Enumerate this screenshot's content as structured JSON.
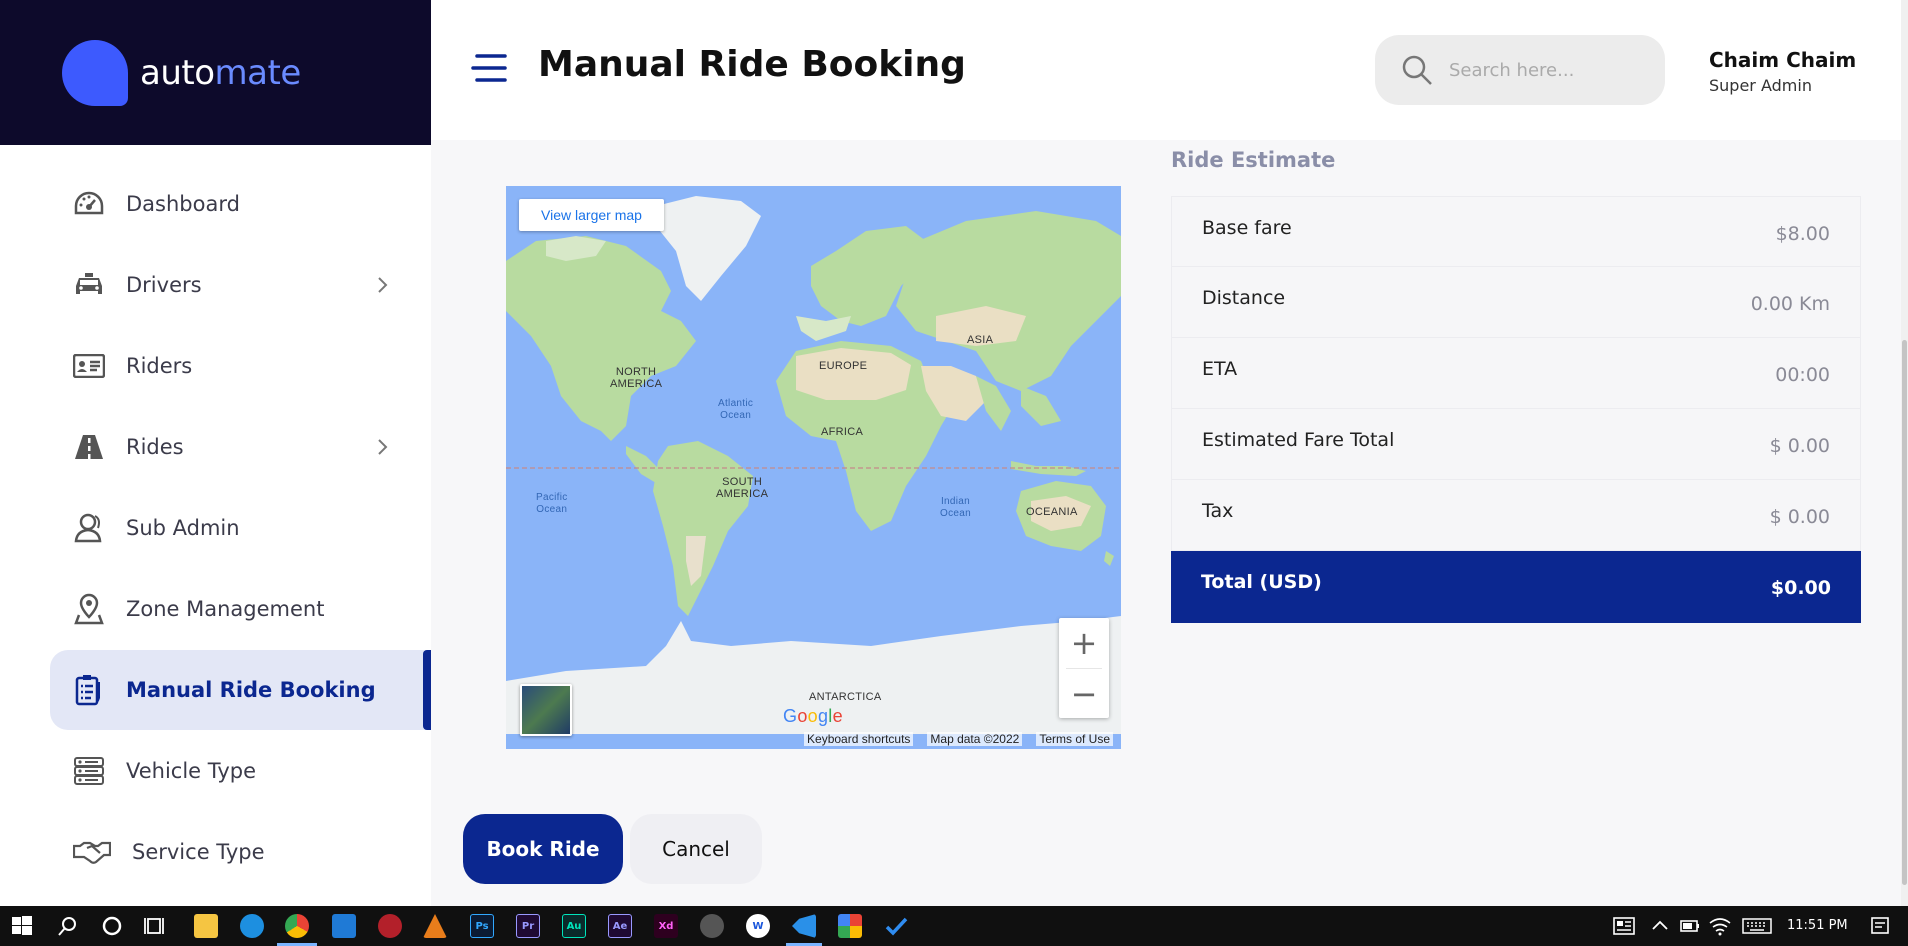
{
  "app": {
    "brand_part1": "auto",
    "brand_part2": "mate",
    "page_title": "Manual Ride Booking"
  },
  "header": {
    "search_placeholder": "Search here...",
    "user_name": "Chaim Chaim",
    "user_role": "Super Admin"
  },
  "sidebar": {
    "items": [
      {
        "label": "Dashboard",
        "icon": "dashboard-icon"
      },
      {
        "label": "Drivers",
        "icon": "car-icon",
        "expandable": true
      },
      {
        "label": "Riders",
        "icon": "id-card-icon"
      },
      {
        "label": "Rides",
        "icon": "road-icon",
        "expandable": true
      },
      {
        "label": "Sub Admin",
        "icon": "users-icon"
      },
      {
        "label": "Zone Management",
        "icon": "location-icon"
      },
      {
        "label": "Manual Ride Booking",
        "icon": "clipboard-icon",
        "active": true
      },
      {
        "label": "Vehicle Type",
        "icon": "list-icon"
      },
      {
        "label": "Service Type",
        "icon": "handshake-icon"
      }
    ]
  },
  "map": {
    "view_larger": "View larger map",
    "zoom_in": "+",
    "zoom_out": "−",
    "google": "Google",
    "keyboard_shortcuts": "Keyboard shortcuts",
    "map_data": "Map data ©2022",
    "terms": "Terms of Use",
    "labels": {
      "north_america_1": "NORTH",
      "north_america_2": "AMERICA",
      "south_america_1": "SOUTH",
      "south_america_2": "AMERICA",
      "europe": "EUROPE",
      "asia": "ASIA",
      "africa": "AFRICA",
      "oceania": "OCEANIA",
      "antarctica": "ANTARCTICA",
      "atlantic_1": "Atlantic",
      "atlantic_2": "Ocean",
      "pacific_1": "Pacific",
      "pacific_2": "Ocean",
      "indian_1": "Indian",
      "indian_2": "Ocean"
    }
  },
  "estimate": {
    "title": "Ride Estimate",
    "rows": [
      {
        "label": "Base fare",
        "value": "$8.00"
      },
      {
        "label": "Distance",
        "value": "0.00 Km"
      },
      {
        "label": "ETA",
        "value": "00:00"
      },
      {
        "label": "Estimated Fare Total",
        "value": "$ 0.00"
      },
      {
        "label": "Tax",
        "value": "$ 0.00"
      }
    ],
    "total_label": "Total (USD)",
    "total_value": "$0.00"
  },
  "actions": {
    "book": "Book Ride",
    "cancel": "Cancel"
  },
  "taskbar": {
    "time": "11:51 PM"
  },
  "colors": {
    "primary": "#0b2790",
    "brand_blue": "#3d5afe",
    "sidebar_header": "#0d0a2b",
    "active_bg": "#e3e7f6",
    "map_water": "#8ab4f8",
    "map_land": "#b8dba0"
  }
}
